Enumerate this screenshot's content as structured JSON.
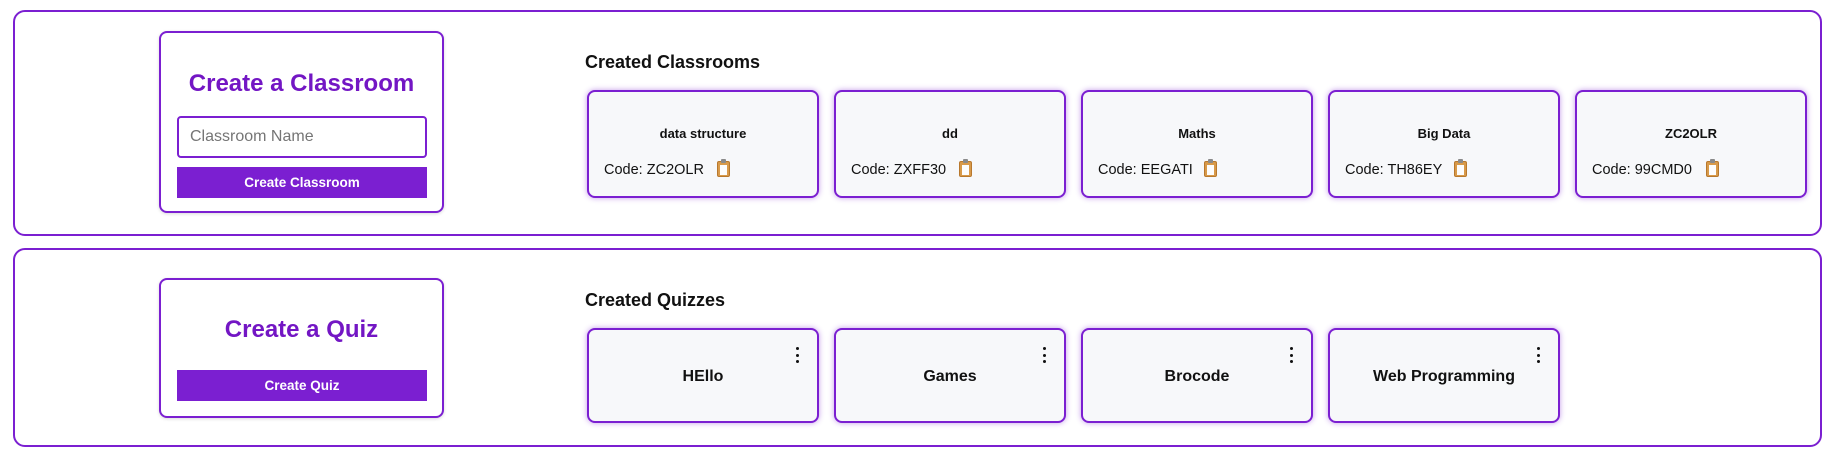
{
  "classrooms_section": {
    "create_title": "Create a Classroom",
    "input_placeholder": "Classroom Name",
    "input_value": "",
    "create_button": "Create Classroom",
    "list_heading": "Created Classrooms",
    "code_prefix": "Code: ",
    "copy_icon": "clipboard-icon",
    "classrooms": [
      {
        "name": "data structure",
        "code": "ZC2OLR"
      },
      {
        "name": "dd",
        "code": "ZXFF30"
      },
      {
        "name": "Maths",
        "code": "EEGATI"
      },
      {
        "name": "Big Data",
        "code": "TH86EY"
      },
      {
        "name": "ZC2OLR",
        "code": "99CMD0"
      }
    ]
  },
  "quizzes_section": {
    "create_title": "Create a Quiz",
    "create_button": "Create Quiz",
    "list_heading": "Created Quizzes",
    "menu_icon": "kebab-menu-icon",
    "quizzes": [
      {
        "title": "HEllo"
      },
      {
        "title": "Games"
      },
      {
        "title": "Brocode"
      },
      {
        "title": "Web Programming"
      }
    ]
  },
  "colors": {
    "accent": "#7b1fd1",
    "title_purple": "#7316c4",
    "card_bg": "#f7f8fa"
  }
}
